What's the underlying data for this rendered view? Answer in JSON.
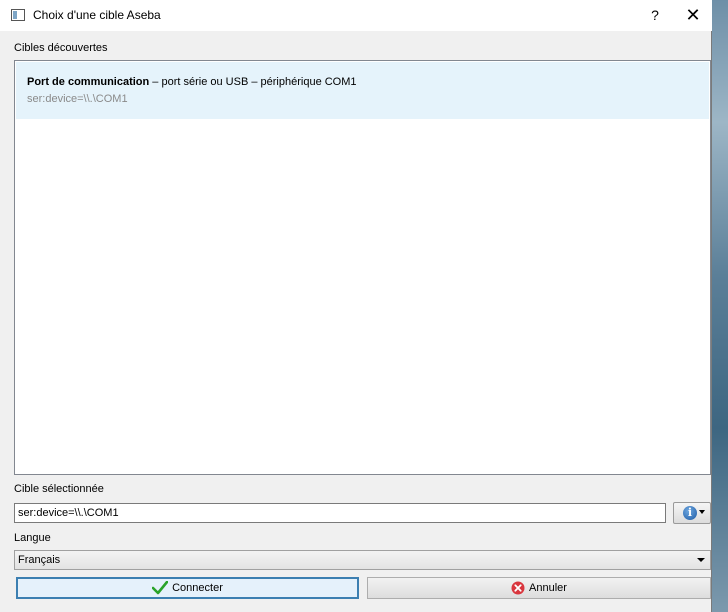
{
  "window": {
    "title": "Choix d'une cible Aseba",
    "help_label": "?",
    "close_label": "✕"
  },
  "targets": {
    "section_label": "Cibles découvertes",
    "items": [
      {
        "name": "Port de communication",
        "description": " – port série ou USB – périphérique COM1",
        "target": "ser:device=\\\\.\\COM1"
      }
    ]
  },
  "selected": {
    "label": "Cible sélectionnée",
    "value": "ser:device=\\\\.\\COM1"
  },
  "language": {
    "label": "Langue",
    "selected": "Français"
  },
  "buttons": {
    "connect_label": "Connecter",
    "cancel_label": "Annuler"
  },
  "icons": {
    "app": "window-icon",
    "info": "info-icon",
    "connect": "checkmark-icon",
    "cancel": "cancel-icon"
  },
  "colors": {
    "selection": "#e5f3fb",
    "accent": "#3c7fb1",
    "check": "#2aa32a",
    "cancel": "#d9363e"
  }
}
